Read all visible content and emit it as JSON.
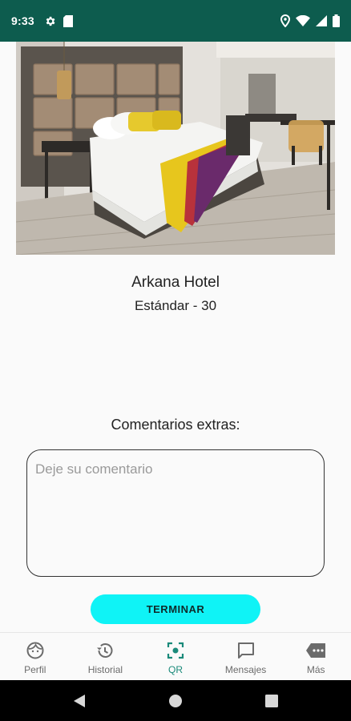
{
  "status_bar": {
    "time": "9:33",
    "background": "#0d5c4e",
    "left_icons": [
      "gear-icon",
      "sim-card-icon"
    ],
    "right_icons": [
      "location-icon",
      "wifi-icon",
      "signal-icon",
      "battery-icon"
    ]
  },
  "hero": {
    "image_description": "hotel-room-photo"
  },
  "hotel": {
    "name": "Arkana Hotel",
    "room": "Estándar - 30"
  },
  "comments": {
    "label": "Comentarios extras:",
    "placeholder": "Deje su comentario",
    "value": ""
  },
  "actions": {
    "finish_label": "TERMINAR",
    "finish_color": "#0ff3f6"
  },
  "bottom_nav": {
    "active_color": "#1a8a7a",
    "items": [
      {
        "label": "Perfil",
        "icon": "face-icon"
      },
      {
        "label": "Historial",
        "icon": "history-icon"
      },
      {
        "label": "QR",
        "icon": "qr-scanner-icon",
        "active": true
      },
      {
        "label": "Mensajes",
        "icon": "message-icon"
      },
      {
        "label": "Más",
        "icon": "more-icon"
      }
    ]
  }
}
